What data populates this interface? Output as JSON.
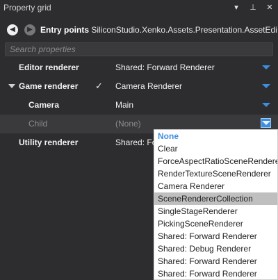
{
  "window": {
    "title": "Property grid",
    "controls": [
      "chevron-down-icon",
      "pin-icon",
      "close-icon"
    ],
    "control_glyphs": [
      "▾",
      "⊥",
      "✕"
    ]
  },
  "nav": {
    "back_glyph": "◀",
    "forward_glyph": "▶",
    "bold": "Entry points",
    "path": "SiliconStudio.Xenko.Assets.Presentation.AssetEdi..."
  },
  "search": {
    "placeholder": "Search properties",
    "value": ""
  },
  "properties": {
    "editor_renderer": {
      "label": "Editor renderer",
      "value": "Shared: Forward Renderer"
    },
    "game_renderer": {
      "label": "Game renderer",
      "checked": "✓",
      "value": "Camera Renderer"
    },
    "camera": {
      "label": "Camera",
      "value": "Main"
    },
    "child": {
      "label": "Child",
      "value": "(None)"
    },
    "utility_renderer": {
      "label": "Utility renderer",
      "value": "Shared: Fo"
    }
  },
  "dropdown": {
    "options": [
      "None",
      "Clear",
      "ForceAspectRatioSceneRenderer",
      "RenderTextureSceneRenderer",
      "Camera Renderer",
      "SceneRendererCollection",
      "SingleStageRenderer",
      "PickingSceneRenderer",
      "Shared: Forward Renderer",
      "Shared: Debug Renderer",
      "Shared: Forward Renderer",
      "Shared: Forward Renderer"
    ],
    "selected_index": 0,
    "hover_index": 5
  },
  "colors": {
    "background": "#2d2d30",
    "accent": "#3d8ee0",
    "text": "#f1f1f1",
    "disabled_text": "#8b8b8b"
  }
}
